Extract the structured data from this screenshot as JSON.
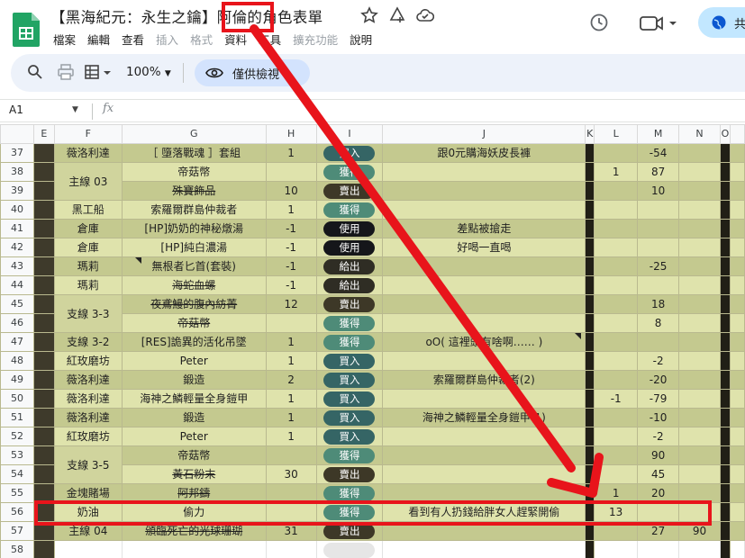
{
  "doc": {
    "title": "【黑海紀元：永生之鑰】阿倫的角色表單",
    "menu": [
      "檔案",
      "編輯",
      "查看",
      "插入",
      "格式",
      "資料",
      "工具",
      "擴充功能",
      "說明"
    ],
    "menu_disabled": [
      false,
      false,
      false,
      true,
      true,
      false,
      false,
      true,
      false
    ]
  },
  "share_label": "共",
  "toolbar": {
    "zoom": "100%",
    "view_only": "僅供檢視"
  },
  "formula": {
    "cell_ref": "A1",
    "fx": "fx"
  },
  "columns": [
    "E",
    "F",
    "G",
    "H",
    "I",
    "J",
    "K",
    "L",
    "M",
    "N",
    "O"
  ],
  "rows": [
    {
      "n": "37",
      "f": "薇洛利達",
      "g": "［ 墮落戰魂 ］套組",
      "h": "1",
      "i": "買入",
      "ik": "buy",
      "j": "跟0元購海妖皮長褲",
      "l": "",
      "m": "-54",
      "n2": ""
    },
    {
      "n": "38",
      "f": "主線 03",
      "g": "帝菇幣",
      "h": "",
      "i": "獲得",
      "ik": "gain",
      "j": "",
      "l": "1",
      "m": "87",
      "n2": ""
    },
    {
      "n": "39",
      "f": "",
      "g": "殊寶飾品",
      "h": "10",
      "i": "賣出",
      "ik": "sell",
      "j": "",
      "l": "",
      "m": "10",
      "n2": ""
    },
    {
      "n": "40",
      "f": "黑工船",
      "g": "索羅爾群島仲裁者",
      "h": "1",
      "i": "獲得",
      "ik": "gain",
      "j": "",
      "l": "",
      "m": "",
      "n2": ""
    },
    {
      "n": "41",
      "f": "倉庫",
      "g": "[HP]奶奶的神秘燉湯",
      "h": "-1",
      "i": "使用",
      "ik": "use",
      "j": "差點被搶走",
      "l": "",
      "m": "",
      "n2": ""
    },
    {
      "n": "42",
      "f": "倉庫",
      "g": "[HP]純白濃湯",
      "h": "-1",
      "i": "使用",
      "ik": "use",
      "j": "好喝一直喝",
      "l": "",
      "m": "",
      "n2": ""
    },
    {
      "n": "43",
      "f": "瑪莉",
      "g": "無根者匕首(套裝)",
      "h": "-1",
      "i": "給出",
      "ik": "give",
      "j": "",
      "l": "",
      "m": "-25",
      "n2": ""
    },
    {
      "n": "44",
      "f": "瑪莉",
      "g": "海蛇血螺",
      "h": "-1",
      "i": "給出",
      "ik": "give",
      "j": "",
      "l": "",
      "m": "",
      "n2": ""
    },
    {
      "n": "45",
      "f": "支線 3-3",
      "g": "夜鳶鰻的腹內紡菁",
      "h": "12",
      "i": "賣出",
      "ik": "sell",
      "j": "",
      "l": "",
      "m": "18",
      "n2": ""
    },
    {
      "n": "46",
      "f": "",
      "g": "帝菇幣",
      "h": "",
      "i": "獲得",
      "ik": "gain",
      "j": "",
      "l": "",
      "m": "8",
      "n2": ""
    },
    {
      "n": "47",
      "f": "支線 3-2",
      "g": "[RES]詭異的活化吊墜",
      "h": "1",
      "i": "獲得",
      "ik": "gain",
      "j": "oO( 這裡頭有啥啊…… )",
      "l": "",
      "m": "",
      "n2": ""
    },
    {
      "n": "48",
      "f": "紅玫磨坊",
      "g": "Peter",
      "h": "1",
      "i": "買入",
      "ik": "buy",
      "j": "",
      "l": "",
      "m": "-2",
      "n2": ""
    },
    {
      "n": "49",
      "f": "薇洛利達",
      "g": "鍛造",
      "h": "2",
      "i": "買入",
      "ik": "buy",
      "j": "索羅爾群島仲裁者(2)",
      "l": "",
      "m": "-20",
      "n2": ""
    },
    {
      "n": "50",
      "f": "薇洛利達",
      "g": "海神之鱗輕量全身鎧甲",
      "h": "1",
      "i": "買入",
      "ik": "buy",
      "j": "",
      "l": "-1",
      "m": "-79",
      "n2": ""
    },
    {
      "n": "51",
      "f": "薇洛利達",
      "g": "鍛造",
      "h": "1",
      "i": "買入",
      "ik": "buy",
      "j": "海神之鱗輕量全身鎧甲(1)",
      "l": "",
      "m": "-10",
      "n2": ""
    },
    {
      "n": "52",
      "f": "紅玫磨坊",
      "g": "Peter",
      "h": "1",
      "i": "買入",
      "ik": "buy",
      "j": "",
      "l": "",
      "m": "-2",
      "n2": ""
    },
    {
      "n": "53",
      "f": "支線 3-5",
      "g": "帝菇幣",
      "h": "",
      "i": "獲得",
      "ik": "gain",
      "j": "",
      "l": "",
      "m": "90",
      "n2": ""
    },
    {
      "n": "54",
      "f": "",
      "g": "黃石粉末",
      "h": "30",
      "i": "賣出",
      "ik": "sell",
      "j": "",
      "l": "",
      "m": "45",
      "n2": ""
    },
    {
      "n": "55",
      "f": "金塊賭場",
      "g": "阿邦鑄",
      "h": "",
      "i": "獲得",
      "ik": "gain",
      "j": "",
      "l": "1",
      "m": "20",
      "n2": ""
    },
    {
      "n": "56",
      "f": "奶油",
      "g": "偷力",
      "h": "",
      "i": "獲得",
      "ik": "gain",
      "j": "看到有人扔錢給胖女人趕緊開偷",
      "l": "13",
      "m": "",
      "n2": ""
    },
    {
      "n": "57",
      "f": "主線 04",
      "g": "頒臨死亡的光球珊瑚",
      "h": "31",
      "i": "賣出",
      "ik": "sell",
      "j": "",
      "l": "",
      "m": "27",
      "n2": "90"
    },
    {
      "n": "58",
      "f": "",
      "g": "",
      "h": "",
      "i": "",
      "ik": "empty",
      "j": "",
      "l": "",
      "m": "",
      "n2": ""
    }
  ],
  "colors": {
    "band_light": "#dfe3ac",
    "band_dark": "#c4c98f",
    "annotation_red": "#e8141b"
  }
}
